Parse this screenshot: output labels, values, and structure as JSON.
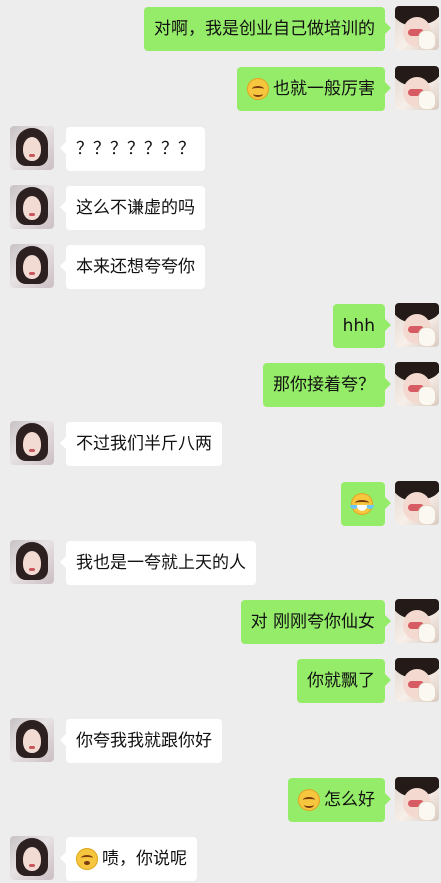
{
  "messages": [
    {
      "side": "right",
      "avatar": "me-avatar",
      "text": "对啊，我是创业自己做培训的",
      "emoji": ""
    },
    {
      "side": "right",
      "avatar": "me-avatar",
      "text": "也就一般厉害",
      "emoji": "smile"
    },
    {
      "side": "left",
      "avatar": "contact-avatar",
      "text": "？？？？？？？",
      "emoji": ""
    },
    {
      "side": "left",
      "avatar": "contact-avatar",
      "text": "这么不谦虚的吗",
      "emoji": ""
    },
    {
      "side": "left",
      "avatar": "contact-avatar",
      "text": "本来还想夸夸你",
      "emoji": ""
    },
    {
      "side": "right",
      "avatar": "me-avatar",
      "text": "hhh",
      "emoji": ""
    },
    {
      "side": "right",
      "avatar": "me-avatar",
      "text": "那你接着夸？",
      "emoji": ""
    },
    {
      "side": "left",
      "avatar": "contact-avatar",
      "text": "不过我们半斤八两",
      "emoji": ""
    },
    {
      "side": "right",
      "avatar": "me-avatar",
      "text": "",
      "emoji": "laugh"
    },
    {
      "side": "left",
      "avatar": "contact-avatar",
      "text": "我也是一夸就上天的人",
      "emoji": ""
    },
    {
      "side": "right",
      "avatar": "me-avatar",
      "text": "对 刚刚夸你仙女",
      "emoji": ""
    },
    {
      "side": "right",
      "avatar": "me-avatar",
      "text": "你就飘了",
      "emoji": ""
    },
    {
      "side": "left",
      "avatar": "contact-avatar",
      "text": "你夸我我就跟你好",
      "emoji": ""
    },
    {
      "side": "right",
      "avatar": "me-avatar",
      "text": "怎么好",
      "emoji": "smile"
    },
    {
      "side": "left",
      "avatar": "contact-avatar",
      "text": "啧，你说呢",
      "emoji": "shy"
    }
  ],
  "colors": {
    "background": "#ededed",
    "sent_bubble": "#95ec69",
    "received_bubble": "#ffffff"
  }
}
